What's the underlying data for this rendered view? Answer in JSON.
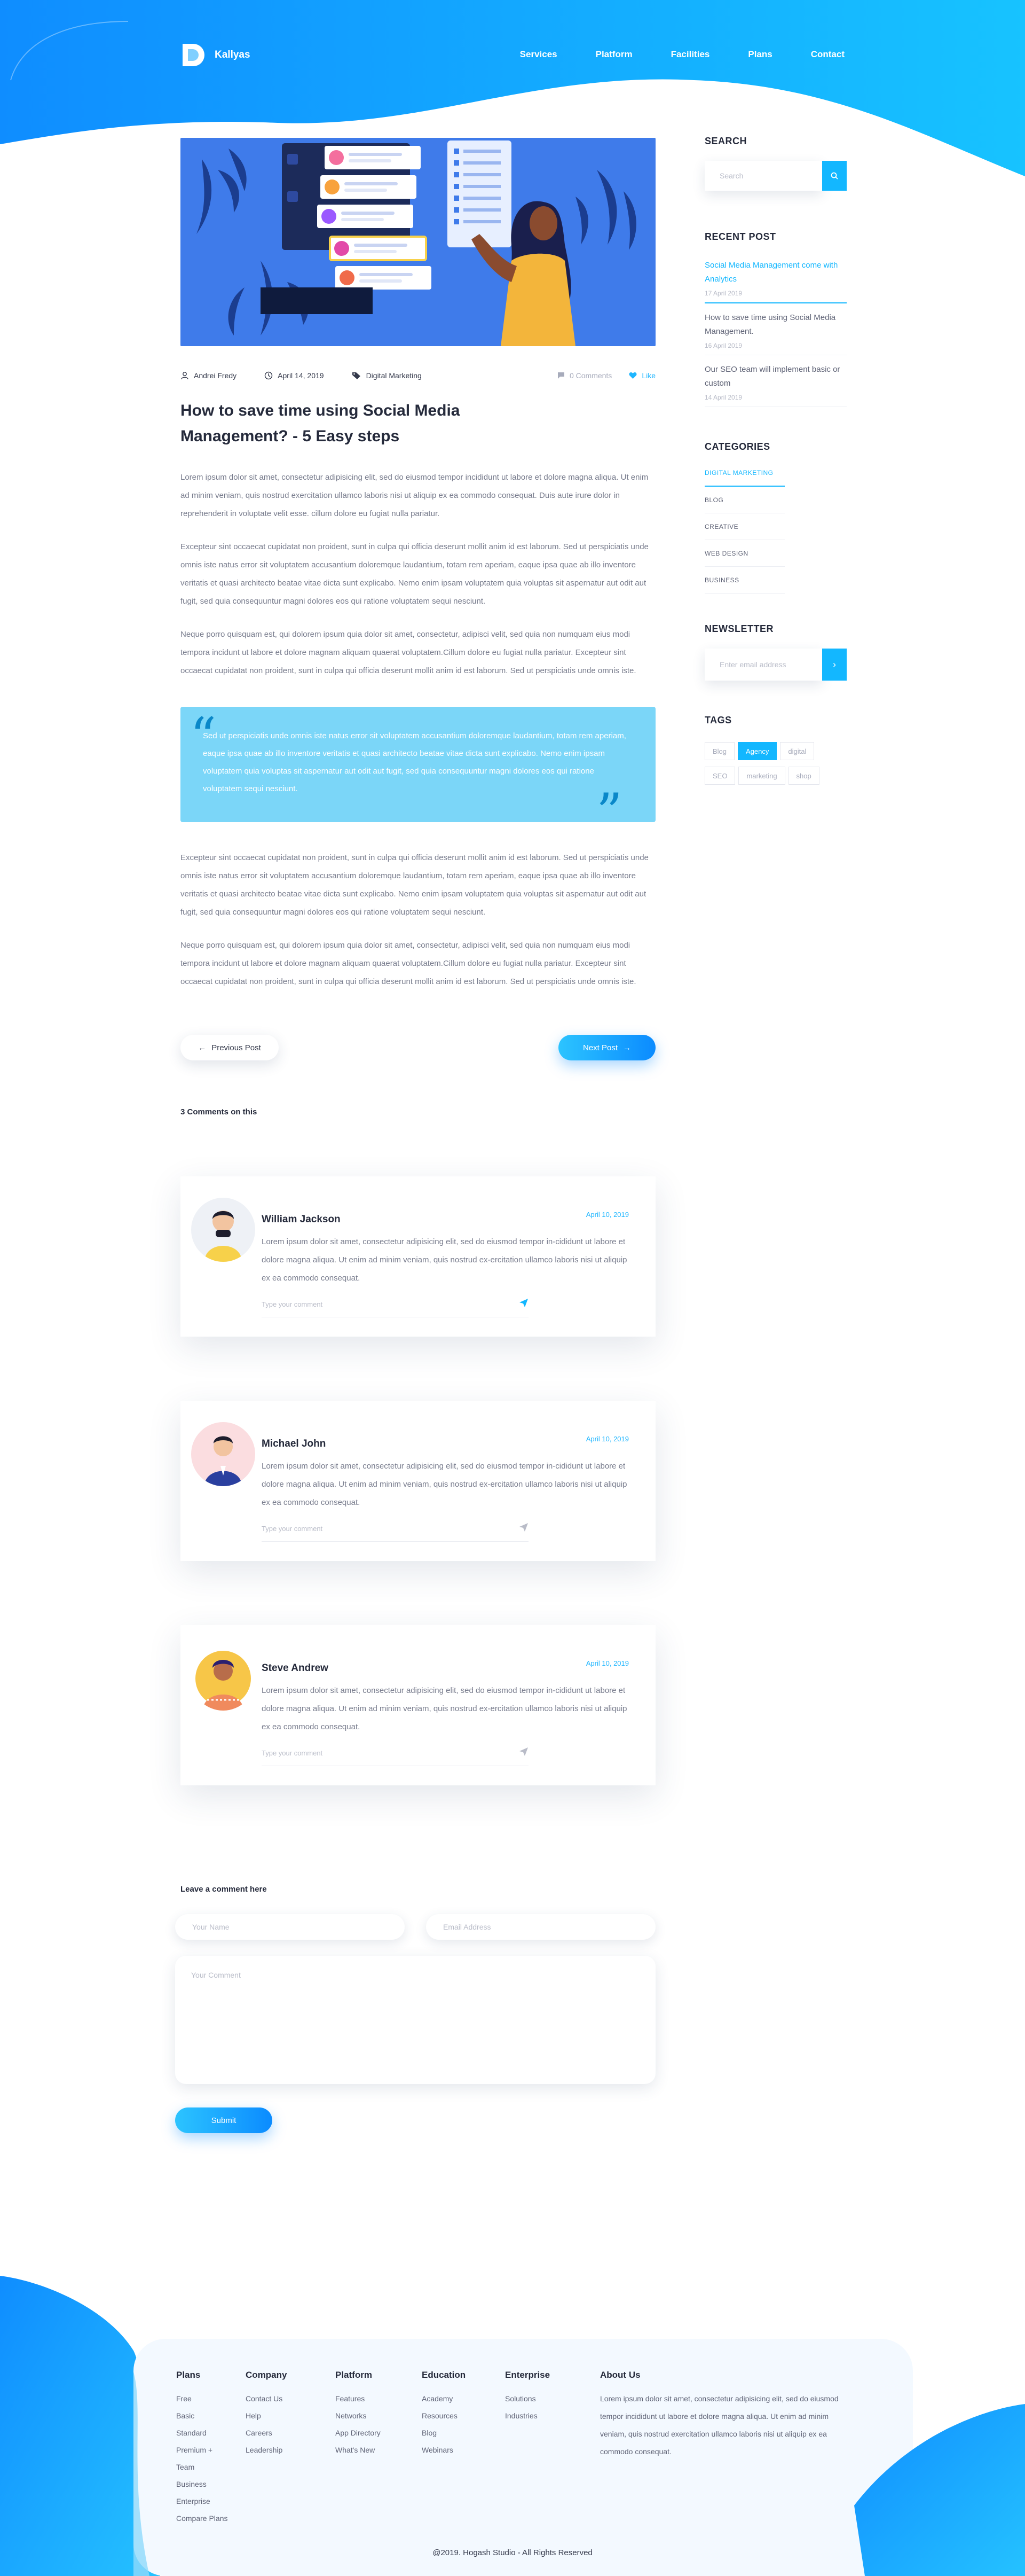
{
  "brand": {
    "name": "Kallyas"
  },
  "nav": {
    "items": [
      "Services",
      "Platform",
      "Facilities",
      "Plans",
      "Contact"
    ]
  },
  "post": {
    "author": "Andrei Fredy",
    "date": "April 14, 2019",
    "category": "Digital Marketing",
    "comments_count": "0 Comments",
    "likes": "Like",
    "title": "How to save time using Social Media Management? - 5 Easy steps",
    "paragraphs_top": [
      "Lorem ipsum dolor sit amet, consectetur adipisicing elit, sed do eiusmod tempor incididunt ut labore et dolore magna aliqua. Ut enim ad minim veniam, quis nostrud exercitation ullamco laboris nisi ut aliquip ex ea commodo consequat. Duis aute irure dolor in reprehenderit in voluptate velit esse. cillum dolore eu fugiat nulla pariatur.",
      "Excepteur sint occaecat cupidatat non proident, sunt in culpa qui officia deserunt mollit anim id est laborum. Sed ut perspiciatis unde omnis iste natus error sit voluptatem accusantium doloremque laudantium, totam rem aperiam, eaque ipsa quae ab illo inventore veritatis et quasi architecto beatae vitae dicta sunt explicabo. Nemo enim ipsam voluptatem quia voluptas sit aspernatur aut odit aut fugit, sed quia consequuntur magni dolores eos qui ratione voluptatem sequi nesciunt.",
      "Neque porro quisquam est, qui dolorem ipsum quia dolor sit amet, consectetur, adipisci velit, sed quia non numquam eius modi tempora incidunt ut labore et dolore magnam aliquam quaerat voluptatem.Cillum dolore eu fugiat nulla pariatur. Excepteur sint occaecat cupidatat non proident, sunt in culpa qui officia deserunt mollit anim id est laborum. Sed ut perspiciatis unde omnis iste."
    ],
    "quote": "Sed ut perspiciatis unde omnis iste natus error sit voluptatem accusantium doloremque laudantium, totam rem aperiam, eaque ipsa quae ab illo inventore veritatis et quasi architecto beatae vitae dicta sunt explicabo. Nemo enim ipsam voluptatem quia voluptas sit aspernatur aut odit aut fugit, sed quia consequuntur magni dolores eos qui ratione voluptatem sequi nesciunt.",
    "paragraphs_bottom": [
      "Excepteur sint occaecat cupidatat non proident, sunt in culpa qui officia deserunt mollit anim id est laborum. Sed ut perspiciatis unde omnis iste natus error sit voluptatem accusantium doloremque laudantium, totam rem aperiam, eaque ipsa quae ab illo inventore veritatis et quasi architecto beatae vitae dicta sunt explicabo. Nemo enim ipsam voluptatem quia voluptas sit aspernatur aut odit aut fugit, sed quia consequuntur magni dolores eos qui ratione voluptatem sequi nesciunt.",
      "Neque porro quisquam est, qui dolorem ipsum quia dolor sit amet, consectetur, adipisci velit, sed quia non numquam eius modi tempora incidunt ut labore et dolore magnam aliquam quaerat voluptatem.Cillum dolore eu fugiat nulla pariatur. Excepteur sint occaecat cupidatat non proident, sunt in culpa qui officia deserunt mollit anim id est laborum. Sed ut perspiciatis unde omnis iste."
    ],
    "prev_label": "Previous Post",
    "next_label": "Next Post"
  },
  "comments": {
    "title": "3 Comments on this",
    "reply_placeholder": "Type your comment",
    "items": [
      {
        "name": "William Jackson",
        "date": "April 10, 2019",
        "text": "Lorem ipsum dolor sit amet, consectetur adipisicing elit, sed do eiusmod tempor in-cididunt ut labore et dolore magna aliqua. Ut enim ad minim veniam, quis nostrud ex-ercitation ullamco laboris nisi ut aliquip ex ea commodo consequat."
      },
      {
        "name": "Michael John",
        "date": "April 10, 2019",
        "text": "Lorem ipsum dolor sit amet, consectetur adipisicing elit, sed do eiusmod tempor in-cididunt ut labore et dolore magna aliqua. Ut enim ad minim veniam, quis nostrud ex-ercitation ullamco laboris nisi ut aliquip ex ea commodo consequat."
      },
      {
        "name": "Steve Andrew",
        "date": "April 10, 2019",
        "text": "Lorem ipsum dolor sit amet, consectetur adipisicing elit, sed do eiusmod tempor in-cididunt ut labore et dolore magna aliqua. Ut enim ad minim veniam, quis nostrud ex-ercitation ullamco laboris nisi ut aliquip ex ea commodo consequat."
      }
    ]
  },
  "leave_comment": {
    "title": "Leave a comment here",
    "name_placeholder": "Your Name",
    "email_placeholder": "Email Address",
    "comment_placeholder": "Your Comment",
    "submit_label": "Submit"
  },
  "sidebar": {
    "search_title": "SEARCH",
    "search_placeholder": "Search",
    "recent_title": "RECENT POST",
    "recent": [
      {
        "title": "Social Media Management come with Analytics",
        "date": "17 April 2019"
      },
      {
        "title": "How to save time using Social Media Management.",
        "date": "16 April 2019"
      },
      {
        "title": "Our SEO team will implement basic or custom",
        "date": "14 April 2019"
      }
    ],
    "categories_title": "CATEGORIES",
    "categories": [
      "DIGITAL MARKETING",
      "BLOG",
      "CREATIVE",
      "WEB DESIGN",
      "BUSINESS"
    ],
    "newsletter_title": "NEWSLETTER",
    "newsletter_placeholder": "Enter email address",
    "tags_title": "TAGS",
    "tags": [
      "Blog",
      "Agency",
      "digital",
      "SEO",
      "marketing",
      "shop"
    ]
  },
  "footer": {
    "columns": [
      {
        "title": "Plans",
        "links": [
          "Free",
          "Basic",
          "Standard",
          "Premium +",
          "Team",
          "Business",
          "Enterprise",
          "Compare Plans"
        ]
      },
      {
        "title": "Company",
        "links": [
          "Contact Us",
          "Help",
          "Careers",
          "Leadership"
        ]
      },
      {
        "title": "Platform",
        "links": [
          "Features",
          "Networks",
          "App Directory",
          "What's New"
        ]
      },
      {
        "title": "Education",
        "links": [
          "Academy",
          "Resources",
          "Blog",
          "Webinars"
        ]
      },
      {
        "title": "Enterprise",
        "links": [
          "Solutions",
          "Industries"
        ]
      }
    ],
    "about_title": "About Us",
    "about_text": "Lorem ipsum dolor sit amet, consectetur adipisicing elit, sed do eiusmod tempor incididunt ut labore et dolore magna aliqua. Ut enim ad minim veniam, quis nostrud exercitation ullamco laboris nisi ut aliquip ex ea commodo consequat.",
    "copyright": "@2019. Hogash Studio - All Rights Reserved"
  },
  "colors": {
    "accent": "#13b7ff",
    "quote_bg": "#7bd6f8",
    "heading": "#252a3b"
  }
}
